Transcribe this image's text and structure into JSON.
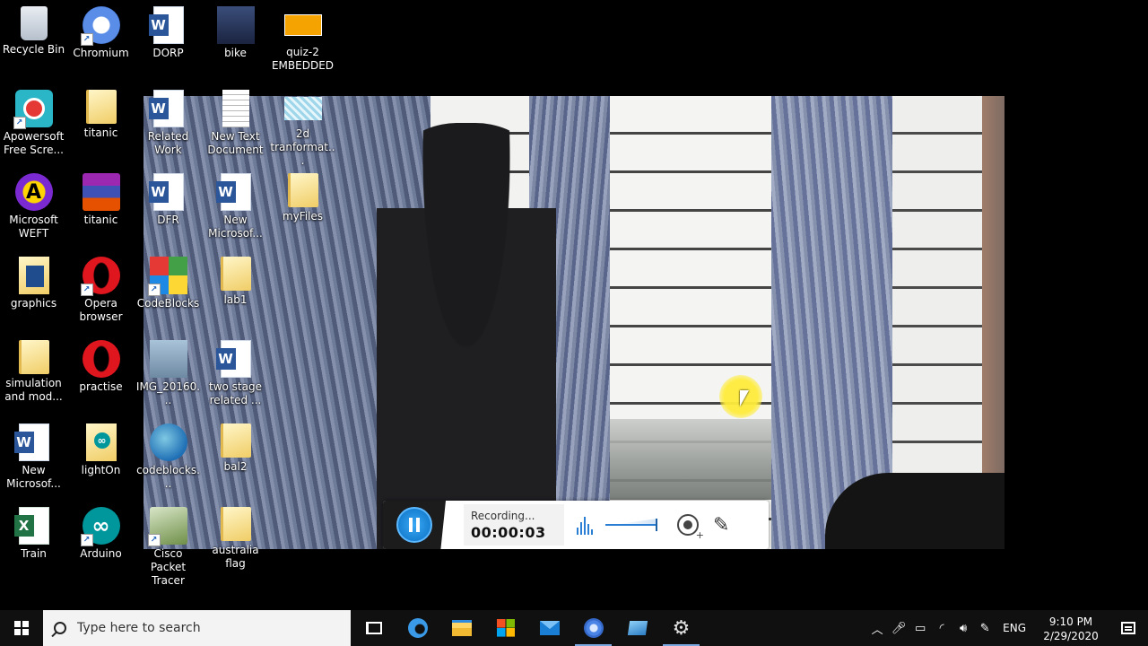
{
  "desktop": {
    "icons": [
      {
        "label": "Recycle Bin"
      },
      {
        "label": "Chromium"
      },
      {
        "label": "DORP"
      },
      {
        "label": "bike"
      },
      {
        "label": "quiz-2 EMBEDDED"
      },
      {
        "label": "Apowersoft Free Scre..."
      },
      {
        "label": "titanic"
      },
      {
        "label": "Related Work"
      },
      {
        "label": "New Text Document"
      },
      {
        "label": "2d tranformat..."
      },
      {
        "label": "Microsoft WEFT"
      },
      {
        "label": "titanic"
      },
      {
        "label": "DFR"
      },
      {
        "label": "New Microsof..."
      },
      {
        "label": "myFiles"
      },
      {
        "label": "graphics"
      },
      {
        "label": "Opera browser"
      },
      {
        "label": "CodeBlocks"
      },
      {
        "label": "lab1"
      },
      {
        "label": "simulation and mod..."
      },
      {
        "label": "practise"
      },
      {
        "label": "IMG_20160..."
      },
      {
        "label": "two stage related ..."
      },
      {
        "label": "New Microsof..."
      },
      {
        "label": "lightOn"
      },
      {
        "label": "codeblocks..."
      },
      {
        "label": "bal2"
      },
      {
        "label": "Train"
      },
      {
        "label": "Arduino"
      },
      {
        "label": "Cisco Packet Tracer"
      },
      {
        "label": "australia flag"
      }
    ]
  },
  "recorder": {
    "status_label": "Recording...",
    "elapsed_time": "00:00:03"
  },
  "taskbar": {
    "search_placeholder": "Type here to search",
    "tray": {
      "language": "ENG",
      "time": "9:10 PM",
      "date": "2/29/2020"
    }
  },
  "colors": {
    "taskbar_bg": "#101010",
    "accent": "#2a7fd4",
    "cursor_highlight": "#ffec3c"
  }
}
